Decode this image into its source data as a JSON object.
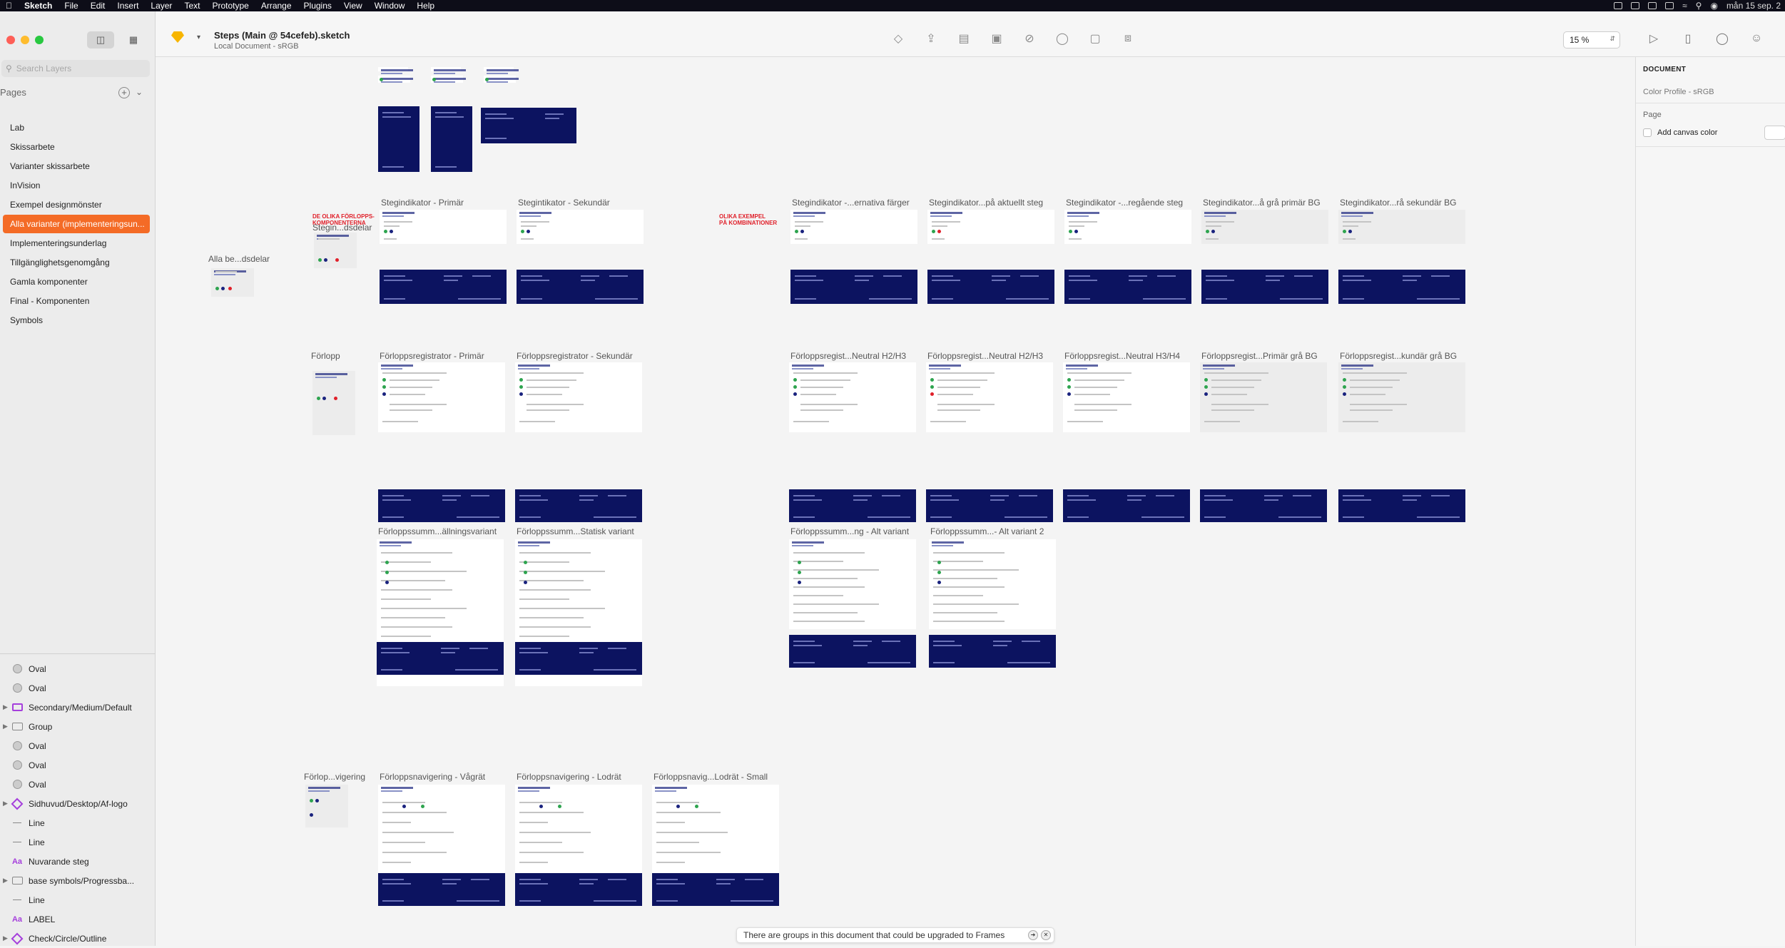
{
  "menubar": {
    "app": "Sketch",
    "items": [
      "File",
      "Edit",
      "Insert",
      "Layer",
      "Text",
      "Prototype",
      "Arrange",
      "Plugins",
      "View",
      "Window",
      "Help"
    ],
    "clock": "mån 15 sep. 2"
  },
  "sidebar": {
    "search_placeholder": "Search Layers",
    "pages_header": "Pages",
    "pages": [
      "Lab",
      "Skissarbete",
      "Varianter skissarbete",
      "InVision",
      "Exempel designmönster",
      "Alla varianter (implementeringsun...",
      "Implementeringsunderlag",
      "Tillgänglighetsgenomgång",
      "Gamla komponenter",
      "Final - Komponenten",
      "Symbols"
    ],
    "selected_page_index": 5,
    "layers": [
      {
        "label": "Oval",
        "type": "oval",
        "expandable": false
      },
      {
        "label": "Oval",
        "type": "oval",
        "expandable": false
      },
      {
        "label": "Secondary/Medium/Default",
        "type": "component",
        "expandable": true
      },
      {
        "label": "Group",
        "type": "group",
        "expandable": true
      },
      {
        "label": "Oval",
        "type": "oval",
        "expandable": false
      },
      {
        "label": "Oval",
        "type": "oval",
        "expandable": false
      },
      {
        "label": "Oval",
        "type": "oval",
        "expandable": false
      },
      {
        "label": "Sidhuvud/Desktop/Af-logo",
        "type": "symbol",
        "expandable": true
      },
      {
        "label": "Line",
        "type": "line",
        "expandable": false
      },
      {
        "label": "Line",
        "type": "line",
        "expandable": false
      },
      {
        "label": "Nuvarande steg",
        "type": "text",
        "expandable": false
      },
      {
        "label": "base symbols/Progressba...",
        "type": "group",
        "expandable": true
      },
      {
        "label": "Line",
        "type": "line",
        "expandable": false
      },
      {
        "label": "LABEL",
        "type": "text",
        "expandable": false
      },
      {
        "label": "Check/Circle/Outline",
        "type": "symbol",
        "expandable": true
      }
    ]
  },
  "toolbar": {
    "doc_title": "Steps (Main @ 54cefeb).sketch",
    "doc_subtitle": "Local Document - sRGB",
    "zoom": "15 %"
  },
  "inspector": {
    "header": "DOCUMENT",
    "color_profile": "Color Profile - sRGB",
    "page_label": "Page",
    "canvas_color_label": "Add canvas color"
  },
  "canvas": {
    "row1_labels": [
      "Stegindikator - Primär",
      "Stegintikator - Sekundär",
      "Stegindikator -...ernativa färger",
      "Stegindikator...på aktuellt steg",
      "Stegindikator -...regående steg",
      "Stegindikator...å grå primär BG",
      "Stegindikator...rå sekundär BG"
    ],
    "side_label_1": "Alla be...dsdelar",
    "side_label_1b": "Stegin...dsdelar",
    "red_label_1": "DE OLIKA FÖRLOPPS-\nKOMPONENTERNA",
    "red_label_2": "OLIKA EXEMPEL\nPÅ KOMBINATIONER",
    "row2_labels": [
      "Förloppsregistrator - Primär",
      "Förloppsregistrator - Sekundär",
      "Förloppsregist...Neutral H2/H3",
      "Förloppsregist...Neutral H2/H3",
      "Förloppsregist...Neutral H3/H4",
      "Förloppsregist...Primär grå BG",
      "Förloppsregist...kundär grå BG"
    ],
    "side_label_2": "Förlopp",
    "row3_labels": [
      "Förloppssumm...ällningsvariant",
      "Förloppssumm...Statisk variant",
      "Förloppssumm...ng - Alt variant",
      "Förloppssumm...- Alt variant 2"
    ],
    "row4_labels": [
      "Förloppsnavigering - Vågrät",
      "Förloppsnavigering - Lodrät",
      "Förloppsnavig...Lodrät - Small"
    ],
    "side_label_4": "Förlop...vigering"
  },
  "toast": {
    "message": "There are groups in this document that could be upgraded to Frames"
  },
  "colors": {
    "accent": "#f46b26",
    "footer_navy": "#0c1360",
    "red_annotation": "#e0202a",
    "traffic_red": "#fe5f57",
    "traffic_yellow": "#febc2e",
    "traffic_green": "#28c840"
  }
}
